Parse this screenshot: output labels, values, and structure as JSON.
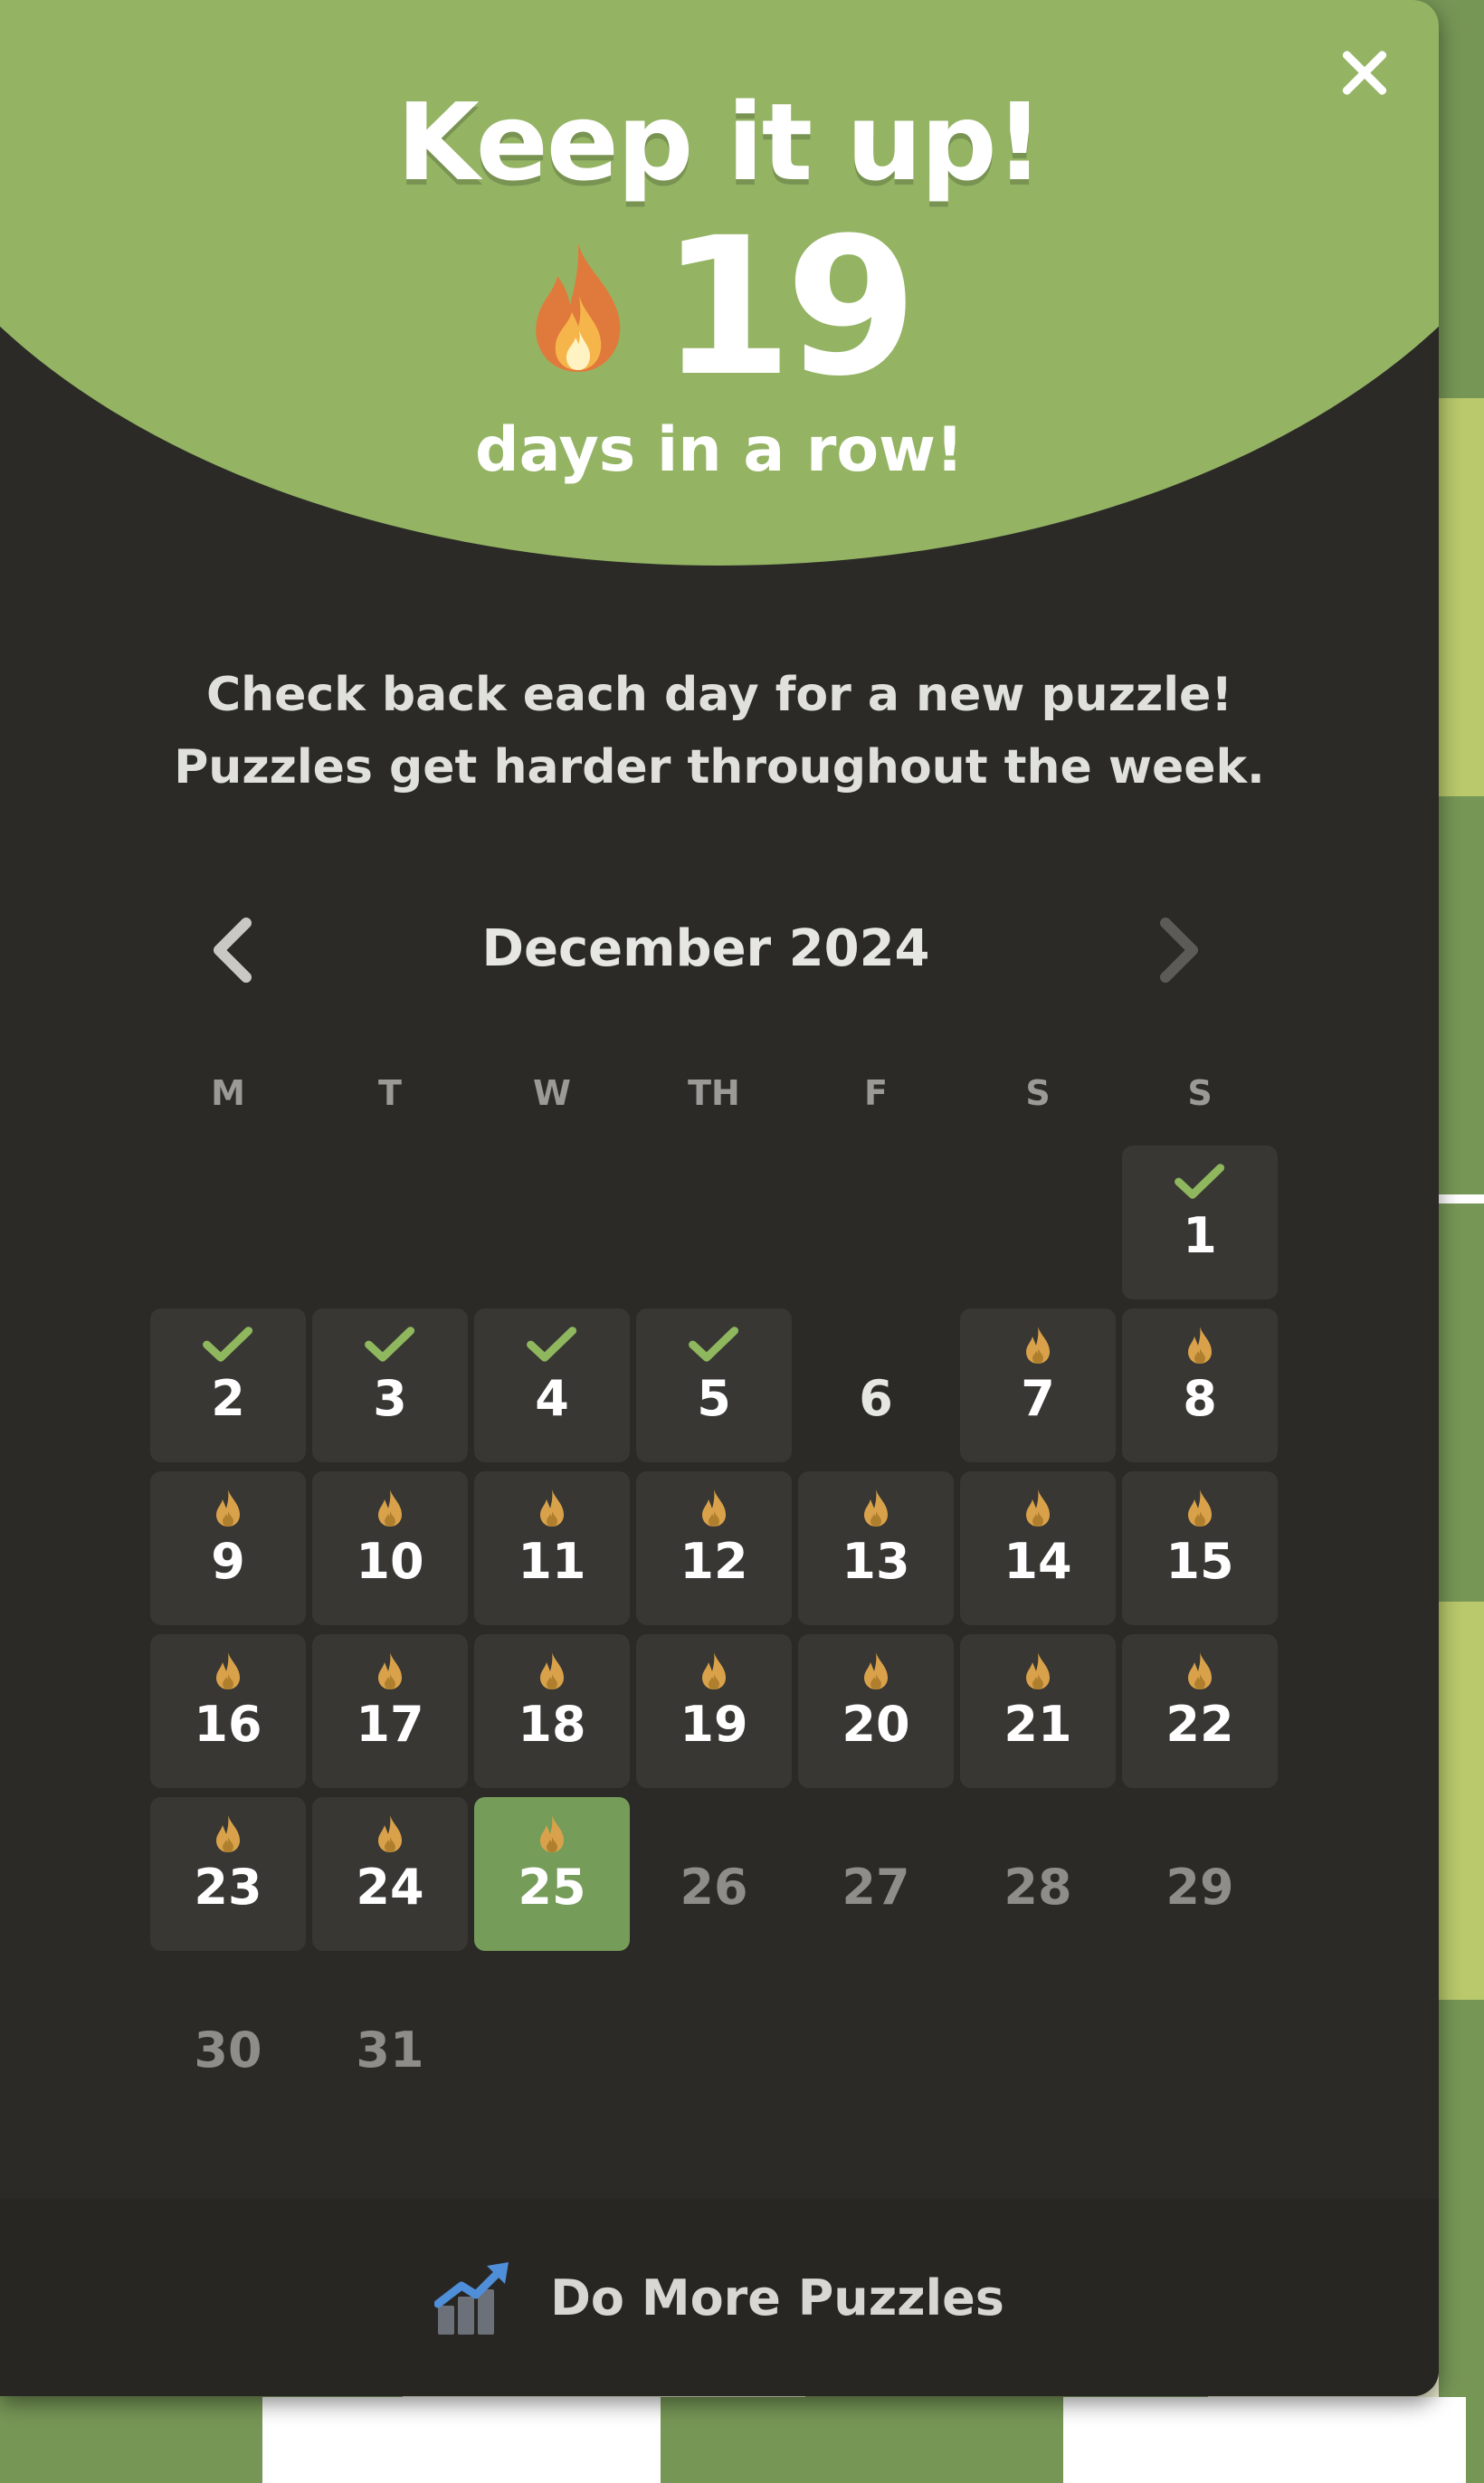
{
  "modal": {
    "title": "Keep it up!",
    "streak_count": "19",
    "streak_label": "days in a row!",
    "message_line1": "Check back each day for a new puzzle!",
    "message_line2": "Puzzles get harder throughout the week."
  },
  "calendar": {
    "month_label": "December 2024",
    "weekdays": [
      "M",
      "T",
      "W",
      "TH",
      "F",
      "S",
      "S"
    ],
    "leading_blank_days": 6,
    "days": [
      {
        "n": "1",
        "status": "done"
      },
      {
        "n": "2",
        "status": "done"
      },
      {
        "n": "3",
        "status": "done"
      },
      {
        "n": "4",
        "status": "done"
      },
      {
        "n": "5",
        "status": "done"
      },
      {
        "n": "6",
        "status": "missed"
      },
      {
        "n": "7",
        "status": "streak"
      },
      {
        "n": "8",
        "status": "streak"
      },
      {
        "n": "9",
        "status": "streak"
      },
      {
        "n": "10",
        "status": "streak"
      },
      {
        "n": "11",
        "status": "streak"
      },
      {
        "n": "12",
        "status": "streak"
      },
      {
        "n": "13",
        "status": "streak"
      },
      {
        "n": "14",
        "status": "streak"
      },
      {
        "n": "15",
        "status": "streak"
      },
      {
        "n": "16",
        "status": "streak"
      },
      {
        "n": "17",
        "status": "streak"
      },
      {
        "n": "18",
        "status": "streak"
      },
      {
        "n": "19",
        "status": "streak"
      },
      {
        "n": "20",
        "status": "streak"
      },
      {
        "n": "21",
        "status": "streak"
      },
      {
        "n": "22",
        "status": "streak"
      },
      {
        "n": "23",
        "status": "streak"
      },
      {
        "n": "24",
        "status": "streak"
      },
      {
        "n": "25",
        "status": "today"
      },
      {
        "n": "26",
        "status": "future"
      },
      {
        "n": "27",
        "status": "future"
      },
      {
        "n": "28",
        "status": "future"
      },
      {
        "n": "29",
        "status": "future"
      },
      {
        "n": "30",
        "status": "future"
      },
      {
        "n": "31",
        "status": "future"
      }
    ]
  },
  "footer": {
    "label": "Do More Puzzles"
  },
  "colors": {
    "header_green": "#94b464",
    "panel_dark": "#2b2a27",
    "today_green": "#769c5a",
    "check_green": "#8fb75e",
    "flame_gold": "#d9a24a"
  },
  "icons": {
    "close": "close-icon",
    "streak": "flame-icon",
    "prev": "chevron-left-icon",
    "next": "chevron-right-icon",
    "done": "checkmark-icon",
    "footer": "trending-chart-icon"
  }
}
